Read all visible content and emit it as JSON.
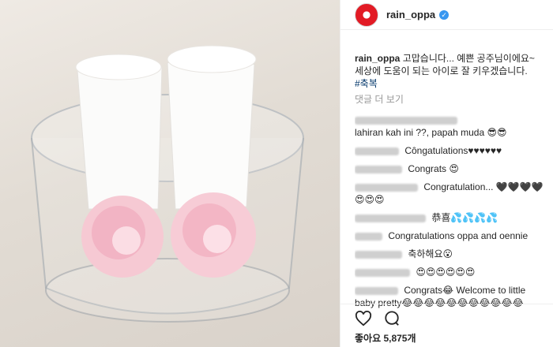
{
  "post": {
    "account": {
      "username": "rain_oppa",
      "verified_icon": "verified-badge-icon"
    },
    "caption": {
      "username": "rain_oppa",
      "text": "고맙습니다... 예쁜 공주님이에요~ 세상에 도움이 되는 아이로 잘 키우겠습니다.",
      "hashtag": "#축복"
    },
    "view_more_comments": "댓글 더 보기",
    "comments": [
      {
        "text": "lahiran kah ini ??, papah muda 😎😎"
      },
      {
        "text": "Côngatulations♥♥♥♥♥♥"
      },
      {
        "text": "Congrats 😍"
      },
      {
        "text": "Congratulation... 🖤🖤🖤🖤😍😍😍"
      },
      {
        "text": "恭喜💦💦💦💦"
      },
      {
        "text": "Congratulations oppa and oennie"
      },
      {
        "text": "축하해요😮"
      },
      {
        "text": "😍😍😍😍😍😍"
      },
      {
        "text": "Congrats😂 Welcome to little baby pretty😂😂😂😂😂😂😂😂😂😂😂"
      }
    ],
    "likes": "좋아요 5,875개",
    "icons": {
      "like": "heart-icon",
      "comment": "comment-icon"
    },
    "colors": {
      "link": "#003569",
      "verified": "#3897f0",
      "avatar": "#e21b25"
    }
  }
}
